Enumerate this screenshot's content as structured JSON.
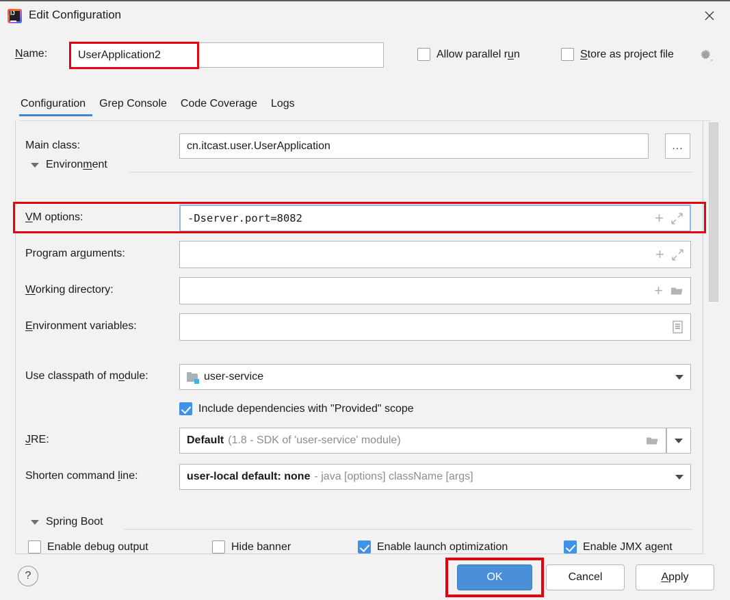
{
  "window": {
    "title": "Edit Configuration",
    "app_icon": "intellij-idea-icon",
    "close_icon": "close-icon"
  },
  "name_row": {
    "label": "Name:",
    "label_mnemonic": "N",
    "value": "UserApplication2",
    "highlighted": true,
    "highlight_color": "#e8000d"
  },
  "header_options": {
    "allow_parallel_run": {
      "label": "Allow parallel run",
      "checked": false,
      "mnemonic": "u"
    },
    "store_as_project_file": {
      "label": "Store as project file",
      "checked": false,
      "mnemonic": "S"
    },
    "gear_icon": "gear-icon"
  },
  "tabs": [
    {
      "label": "Configuration",
      "active": true
    },
    {
      "label": "Grep Console",
      "active": false
    },
    {
      "label": "Code Coverage",
      "active": false
    },
    {
      "label": "Logs",
      "active": false
    }
  ],
  "form": {
    "main_class": {
      "label": "Main class:",
      "value": "cn.itcast.user.UserApplication",
      "browse_label": "..."
    },
    "environment_section": {
      "label": "Environment",
      "expanded": true
    },
    "vm_options": {
      "label": "VM options:",
      "label_mnemonic": "V",
      "value": "-Dserver.port=8082",
      "focused": true,
      "highlighted": true,
      "icons": [
        "plus-icon",
        "expand-icon"
      ]
    },
    "program_arguments": {
      "label": "Program arguments:",
      "label_mnemonic": "g",
      "value": "",
      "icons": [
        "plus-icon",
        "expand-icon"
      ]
    },
    "working_directory": {
      "label": "Working directory:",
      "label_mnemonic": "W",
      "value": "",
      "icons": [
        "plus-icon",
        "folder-icon"
      ]
    },
    "environment_variables": {
      "label": "Environment variables:",
      "label_mnemonic": "E",
      "value": "",
      "icons": [
        "list-icon"
      ]
    },
    "classpath_module": {
      "label": "Use classpath of module:",
      "label_mnemonic": "o",
      "value": "user-service",
      "icon": "module-icon"
    },
    "include_provided": {
      "label": "Include dependencies with \"Provided\" scope",
      "checked": true
    },
    "jre": {
      "label": "JRE:",
      "label_mnemonic": "J",
      "value": "Default",
      "value_detail": "(1.8 - SDK of 'user-service' module)",
      "icons": [
        "folder-icon",
        "chevron-down-icon"
      ]
    },
    "shorten_command_line": {
      "label": "Shorten command line:",
      "label_mnemonic": "l",
      "value": "user-local default: none",
      "value_detail": "- java [options] className [args]",
      "icons": [
        "chevron-down-icon"
      ]
    },
    "spring_boot_section": {
      "label": "Spring Boot",
      "expanded": true
    },
    "spring_boot_options": [
      {
        "label": "Enable debug output",
        "checked": false
      },
      {
        "label": "Hide banner",
        "checked": false
      },
      {
        "label": "Enable launch optimization",
        "checked": true
      },
      {
        "label": "Enable JMX agent",
        "checked": true
      }
    ]
  },
  "buttons": {
    "help": "?",
    "ok": "OK",
    "cancel": "Cancel",
    "apply": "Apply",
    "apply_mnemonic": "A",
    "ok_highlighted": true
  },
  "colors": {
    "accent_blue": "#4a90d9",
    "tab_underline": "#3e86d6",
    "checkbox_checked": "#3e93e8",
    "annotation_red": "#e8000d",
    "dialog_bg": "#f2f2f2"
  }
}
